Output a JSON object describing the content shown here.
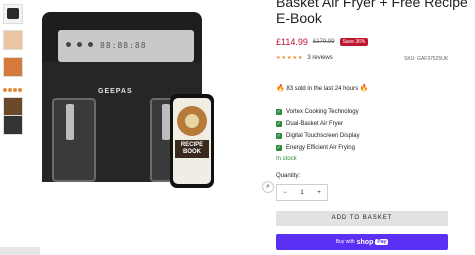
{
  "gallery": {
    "thumbnail_count": 6,
    "zoom_icon": "magnifier-icon",
    "brand_label": "GEEPAS",
    "display_readout": "88:88:88",
    "phone_title": "RECIPE BOOK"
  },
  "product": {
    "title": "Basket Air Fryer + Free Recipe E-Book",
    "price": "£114.99",
    "compare_price": "£179.99",
    "sale_badge": "Save 36%",
    "stars": "★★★★★",
    "reviews": "3 reviews",
    "sku": "SKU: GAF37525UK",
    "sold_text": "83 sold in the last 24 hours",
    "features": [
      "Vortex Cooking Technology",
      "Dual-Basket Air Fryer",
      "Digital Touchscreen Display",
      "Energy Efficient Air Frying"
    ],
    "stock": "In stock",
    "quantity_label": "Quantity:",
    "quantity": "1",
    "add_to_basket": "ADD TO BASKET",
    "shop_pay_prefix": "Buy with",
    "shop_pay_logo": "shop",
    "shop_pay_badge": "Pay"
  },
  "colors": {
    "accent": "#c0152f",
    "in_stock": "#2e8b3a",
    "shop_pay": "#5a31f4"
  }
}
